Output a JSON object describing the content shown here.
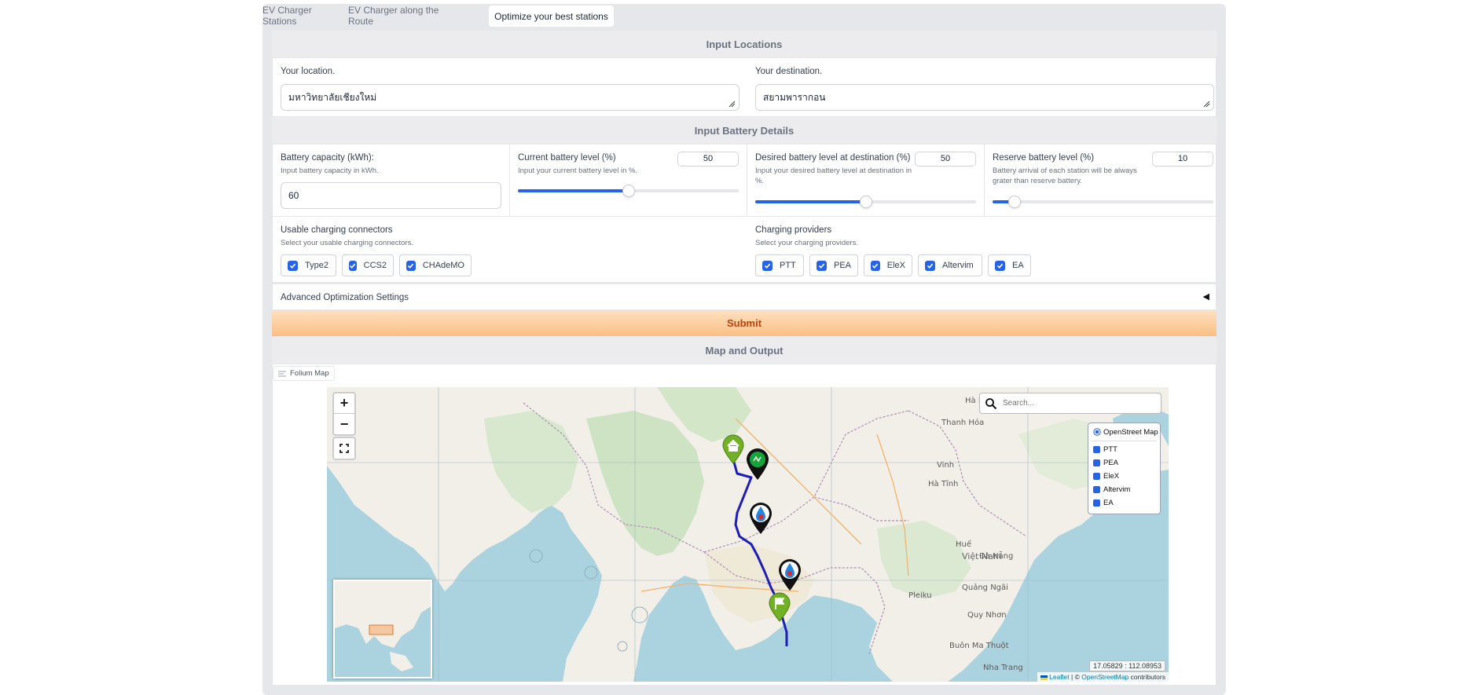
{
  "tabs": [
    {
      "label": "EV Charger Stations"
    },
    {
      "label": "EV Charger along the Route"
    },
    {
      "label": "Optimize your best stations"
    }
  ],
  "sections": {
    "input_locations": "Input Locations",
    "battery_details": "Input Battery Details",
    "map_output": "Map and Output"
  },
  "locations": {
    "origin_label": "Your location.",
    "origin_value": "มหาวิทยาลัยเชียงใหม่",
    "destination_label": "Your destination.",
    "destination_value": "สยามพารากอน"
  },
  "battery": {
    "capacity_label": "Battery capacity (kWh):",
    "capacity_help": "Input battery capacity in kWh.",
    "capacity_value": "60",
    "current_label": "Current battery level (%)",
    "current_help": "Input your current battery level in %.",
    "current_value": "50",
    "current_fraction": 0.5,
    "desired_label": "Desired battery level at destination (%)",
    "desired_help": "Input your desired battery level at destination in %.",
    "desired_value": "50",
    "desired_fraction": 0.5,
    "reserve_label": "Reserve battery level (%)",
    "reserve_help": "Battery arrival of each station will be always grater than reserve battery.",
    "reserve_value": "10",
    "reserve_fraction": 0.1
  },
  "connectors": {
    "label": "Usable charging connectors",
    "help": "Select your usable charging connectors.",
    "items": [
      "Type2",
      "CCS2",
      "CHAdeMO"
    ]
  },
  "providers": {
    "label": "Charging providers",
    "help": "Select your charging providers.",
    "items": [
      "PTT",
      "PEA",
      "EleX",
      "Altervim",
      "EA"
    ]
  },
  "advanced": {
    "label": "Advanced Optimization Settings",
    "arrow": "◀"
  },
  "submit_label": "Submit",
  "map": {
    "tab_label": "Folium Map",
    "search_placeholder": "Search...",
    "base_layer": "OpenStreet Map",
    "overlays": [
      "PTT",
      "PEA",
      "EleX",
      "Altervim",
      "EA"
    ],
    "coords": "17.05829 : 112.08953",
    "attribution_leaflet": "Leaflet",
    "attribution_sep": " | © ",
    "attribution_osm": "OpenStreetMap",
    "attribution_tail": " contributors",
    "place_labels": {
      "hanoi": "Hà Nội",
      "thanh_hoa": "Thanh Hóa",
      "vinh": "Vinh",
      "viet_nam": "Việt Nam",
      "buon": "Buôn Ma Thuột",
      "nha_trang": "Nha Trang",
      "quang_ngai": "Quảng Ngãi",
      "hue": "Huế",
      "da_nang": "Đà Nẵng",
      "ha_tinh": "Hà Tĩnh",
      "pleiku": "Pleiku",
      "qui_nhon": "Quy Nhơn"
    }
  }
}
